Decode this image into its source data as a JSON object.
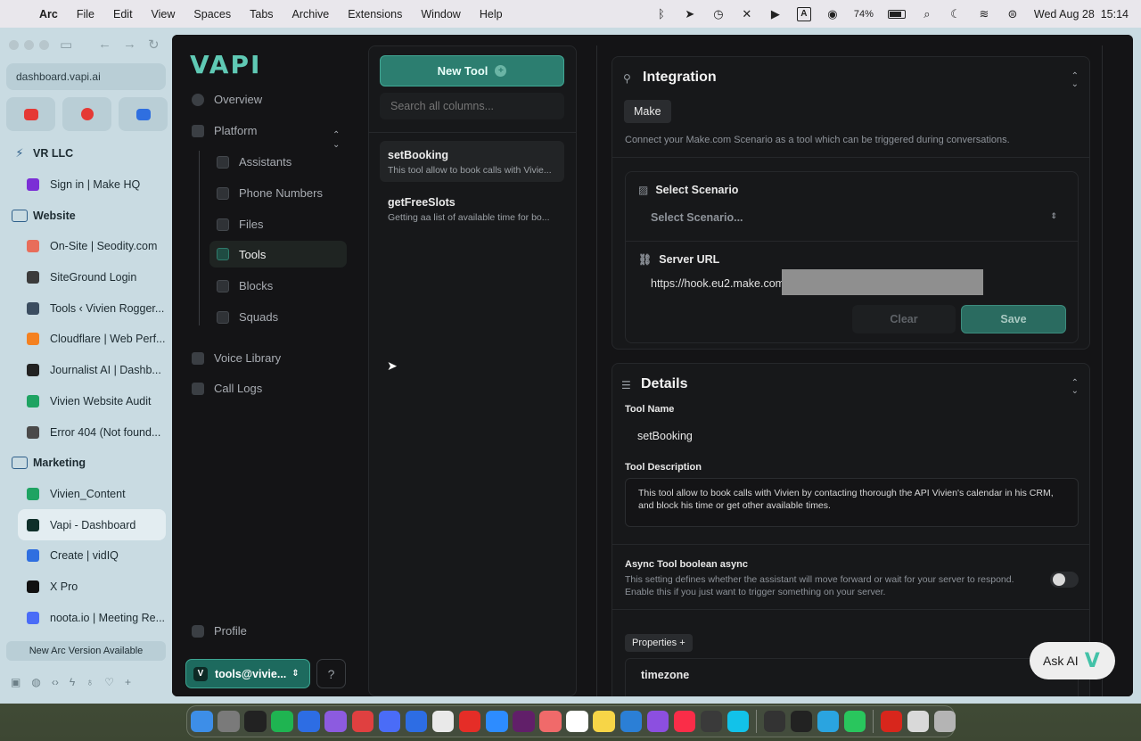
{
  "menubar": {
    "app_name": "Arc",
    "items": [
      "File",
      "Edit",
      "View",
      "Spaces",
      "Tabs",
      "Archive",
      "Extensions",
      "Window",
      "Help"
    ],
    "battery": "74%",
    "datetime": "Wed Aug 28  15:14",
    "status_icons": [
      "bluetooth-icon",
      "send-icon",
      "timer-icon",
      "mute-icon",
      "play-icon",
      "keyboard-input-icon",
      "user-icon",
      "battery-icon",
      "search-icon",
      "moon-icon",
      "wifi-icon",
      "control-center-icon"
    ]
  },
  "arc": {
    "url": "dashboard.vapi.ai",
    "pinned": [
      "youtube-icon",
      "youtube-music-icon",
      "calendar-icon"
    ],
    "pinned_colors": [
      "#e53935",
      "#e53935",
      "#2f6fe0"
    ],
    "tabs": [
      {
        "type": "space",
        "label": "VR LLC"
      },
      {
        "type": "tab",
        "label": "Sign in | Make HQ",
        "color": "#7b2fd6"
      },
      {
        "type": "space",
        "label": "Website"
      },
      {
        "type": "tab",
        "label": "On-Site | Seodity.com",
        "color": "#e86d5a"
      },
      {
        "type": "tab",
        "label": "SiteGround Login",
        "color": "#3b3b3b"
      },
      {
        "type": "tab",
        "label": "Tools ‹ Vivien Rogger...",
        "color": "#3b4d60"
      },
      {
        "type": "tab",
        "label": "Cloudflare | Web Perf...",
        "color": "#f48120"
      },
      {
        "type": "tab",
        "label": "Journalist AI | Dashb...",
        "color": "#222"
      },
      {
        "type": "tab",
        "label": "Vivien Website Audit",
        "color": "#1ea362"
      },
      {
        "type": "tab",
        "label": "Error 404 (Not found...",
        "color": "#4a4a4a"
      },
      {
        "type": "space",
        "label": "Marketing"
      },
      {
        "type": "tab",
        "label": "Vivien_Content",
        "color": "#1ea362"
      },
      {
        "type": "tab",
        "label": "Vapi - Dashboard",
        "color": "#0f2f2a",
        "active": true
      },
      {
        "type": "tab",
        "label": "Create | vidIQ",
        "color": "#2f6fe0"
      },
      {
        "type": "tab",
        "label": "X Pro",
        "color": "#111"
      },
      {
        "type": "tab",
        "label": "noota.io | Meeting Re...",
        "color": "#4a6cf7"
      }
    ],
    "update_banner": "New Arc Version Available"
  },
  "vapi": {
    "logo": "VAPI",
    "nav": {
      "overview": "Overview",
      "platform": "Platform",
      "assistants": "Assistants",
      "phone_numbers": "Phone Numbers",
      "files": "Files",
      "tools": "Tools",
      "blocks": "Blocks",
      "squads": "Squads",
      "voice_library": "Voice Library",
      "call_logs": "Call Logs",
      "profile": "Profile"
    },
    "account": "tools@vivie...",
    "new_tool": "New Tool",
    "search_placeholder": "Search all columns...",
    "tools": [
      {
        "name": "setBooking",
        "desc": "This tool allow to book calls with Vivie..."
      },
      {
        "name": "getFreeSlots",
        "desc": "Getting aa list of available time for bo..."
      }
    ],
    "integration": {
      "title": "Integration",
      "provider": "Make",
      "description": "Connect your Make.com Scenario as a tool which can be triggered during conversations.",
      "select_scenario_label": "Select Scenario",
      "select_scenario_placeholder": "Select Scenario...",
      "server_url_label": "Server URL",
      "server_url_value": "https://hook.eu2.make.com",
      "clear": "Clear",
      "save": "Save"
    },
    "details": {
      "title": "Details",
      "tool_name_label": "Tool Name",
      "tool_name": "setBooking",
      "tool_desc_label": "Tool Description",
      "tool_desc": "This tool allow to book calls with Vivien by contacting thorough the API Vivien's calendar in his CRM, and block his time or get other available times.",
      "async_label": "Async Tool boolean async",
      "async_help": "This setting defines whether the assistant will move forward or wait for your server to respond. Enable this if you just want to trigger something on your server.",
      "properties_button": "Properties +",
      "property_name": "timezone"
    },
    "ask_ai": "Ask AI"
  },
  "dock": {
    "apps": [
      "finder",
      "launchpad",
      "chatgpt",
      "facetime",
      "safari",
      "scrivener",
      "arc",
      "ai-app",
      "safari-alt",
      "chrome",
      "opera",
      "zoom",
      "slack",
      "asana",
      "notion",
      "notes",
      "vscode",
      "podcasts",
      "music",
      "ai-companion",
      "canva",
      "activity-monitor",
      "terminal",
      "telegram",
      "whatsapp",
      "acrobat",
      "preview",
      "trash"
    ],
    "colors": [
      "#3d8ee8",
      "#7a7a7a",
      "#222",
      "#1fb451",
      "#2d6de4",
      "#8c5be0",
      "#e04040",
      "#4a6cf7",
      "#2d6de4",
      "#e9e9e9",
      "#e52d27",
      "#2d8cff",
      "#611f69",
      "#f06a6a",
      "#ffffff",
      "#f7d547",
      "#2b7fd6",
      "#8c4fe0",
      "#fa2d48",
      "#3a3a3a",
      "#12c2e9",
      "#333",
      "#222",
      "#2aa4e0",
      "#29c65d",
      "#d8261c",
      "#d9d9d9",
      "#b4b4b4"
    ]
  }
}
